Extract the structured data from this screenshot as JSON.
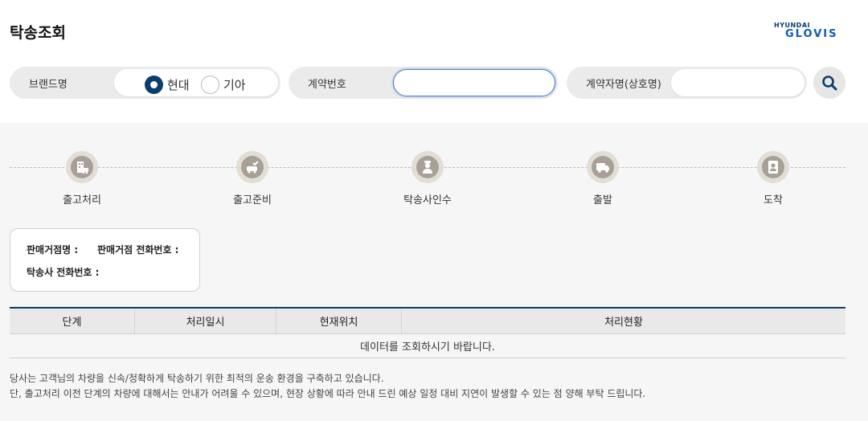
{
  "header": {
    "title": "탁송조회",
    "logo_top": "HYUNDAI",
    "logo_bottom": "GLOVIS"
  },
  "search": {
    "brand_label": "브랜드명",
    "brand_options": [
      "현대",
      "기아"
    ],
    "brand_selected": "현대",
    "contract_label": "계약번호",
    "contract_value": "",
    "name_label": "계약자명(상호명)",
    "name_value": ""
  },
  "steps": [
    {
      "label": "출고처리",
      "icon": "building-car-icon"
    },
    {
      "label": "출고준비",
      "icon": "car-check-icon"
    },
    {
      "label": "탁송사인수",
      "icon": "driver-icon"
    },
    {
      "label": "출발",
      "icon": "truck-icon"
    },
    {
      "label": "도착",
      "icon": "person-icon"
    }
  ],
  "info": {
    "dealer_name_label": "판매거점명 :",
    "dealer_phone_label": "판매거점 전화번호 :",
    "carrier_phone_label": "탁송사 전화번호 :"
  },
  "table": {
    "headers": [
      "단계",
      "처리일시",
      "현재위치",
      "처리현황"
    ],
    "empty_message": "데이터를 조회하시기 바랍니다."
  },
  "notes": [
    "당사는 고객님의 차량을 신속/정확하게 탁송하기 위한 최적의 운송 환경을 구축하고 있습니다.",
    "단, 출고처리 이전 단계의 차량에 대해서는 안내가 어려울 수 있으며, 현장 상황에 따라 안내 드린 예상 일정 대비 지연이 발생할 수 있는 점 양해 부탁 드립니다."
  ],
  "colors": {
    "accent": "#0b3d6e",
    "step_icon": "#a8a096",
    "step_ring": "#e2ddd5"
  }
}
